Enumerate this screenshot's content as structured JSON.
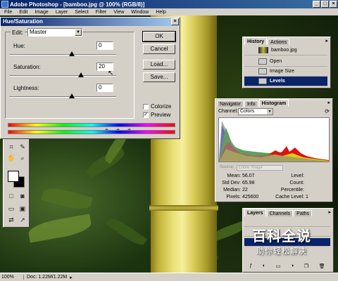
{
  "app": {
    "title": "Adobe Photoshop - [bamboo.jpg @ 100% (RGB/8)]",
    "menu": [
      "File",
      "Edit",
      "Image",
      "Layer",
      "Select",
      "Filter",
      "View",
      "Window",
      "Help"
    ]
  },
  "dialog": {
    "title": "Hue/Saturation",
    "edit_label": "Edit:",
    "edit_value": "Master",
    "hue_label": "Hue:",
    "hue_value": "0",
    "saturation_label": "Saturation:",
    "saturation_value": "20",
    "lightness_label": "Lightness:",
    "lightness_value": "0",
    "ok": "OK",
    "cancel": "Cancel",
    "load": "Load...",
    "save": "Save...",
    "colorize": "Colorize",
    "colorize_checked": false,
    "preview": "Preview",
    "preview_checked": true
  },
  "history": {
    "tabs": [
      "History",
      "Actions"
    ],
    "snapshot": "bamboo.jpg",
    "items": [
      "Open",
      "Image Size",
      "Levels"
    ],
    "selected": "Levels"
  },
  "histogram": {
    "tabs": [
      "Navigator",
      "Info",
      "Histogram"
    ],
    "channel_label": "Channel:",
    "channel_value": "Colors",
    "source_label": "Source:",
    "source_value": "Entire Image",
    "stats": {
      "mean_label": "Mean:",
      "mean": "56.07",
      "stddev_label": "Std Dev:",
      "stddev": "65.98",
      "median_label": "Median:",
      "median": "22",
      "pixels_label": "Pixels:",
      "pixels": "425600",
      "level_label": "Level:",
      "count_label": "Count:",
      "percentile_label": "Percentile:",
      "cache_label": "Cache Level:",
      "cache": "1"
    }
  },
  "layers": {
    "tabs": [
      "Layers",
      "Channels",
      "Paths"
    ]
  },
  "watermark": {
    "main": "百科全说",
    "sub": "助你轻松解决"
  },
  "statusbar": {
    "zoom": "100%",
    "doc": "Doc: 1.22M/1.22M"
  }
}
